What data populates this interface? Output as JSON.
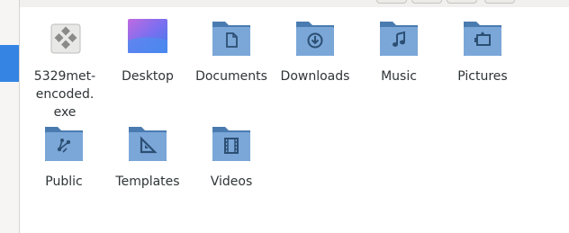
{
  "colors": {
    "folder_back": "#4a7bb0",
    "folder_front": "#7ba7d8",
    "folder_glyph": "#2c4f73",
    "selection": "#3584e4"
  },
  "files": [
    {
      "label": "5329met-\nencoded.\nexe",
      "icon": "executable-icon"
    },
    {
      "label": "Desktop",
      "icon": "desktop-folder-icon"
    },
    {
      "label": "Documents",
      "icon": "documents-folder-icon"
    },
    {
      "label": "Downloads",
      "icon": "downloads-folder-icon"
    },
    {
      "label": "Music",
      "icon": "music-folder-icon"
    },
    {
      "label": "Pictures",
      "icon": "pictures-folder-icon"
    },
    {
      "label": "Public",
      "icon": "public-folder-icon"
    },
    {
      "label": "Templates",
      "icon": "templates-folder-icon"
    },
    {
      "label": "Videos",
      "icon": "videos-folder-icon"
    }
  ]
}
